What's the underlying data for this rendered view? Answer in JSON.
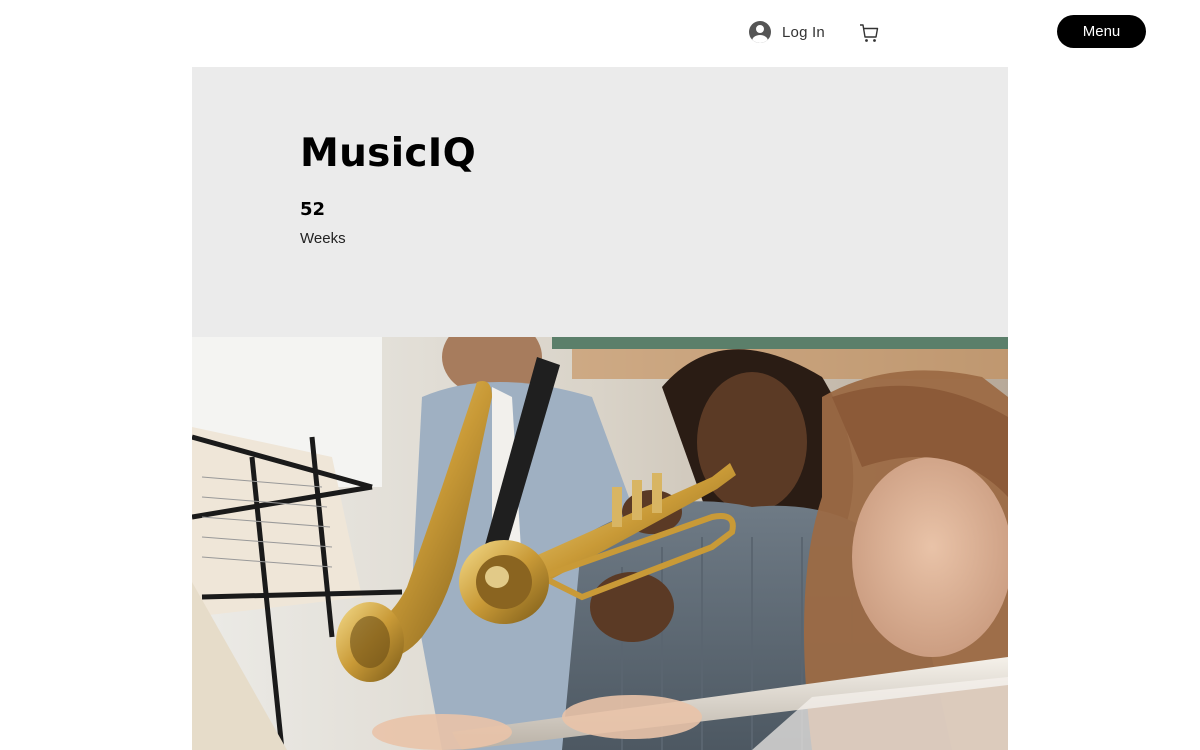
{
  "header": {
    "login_label": "Log In",
    "menu_label": "Menu",
    "icons": {
      "avatar": "user-avatar-icon",
      "cart": "shopping-cart-icon"
    }
  },
  "program": {
    "title": "MusicIQ",
    "duration_value": "52",
    "duration_unit": "Weeks"
  },
  "colors": {
    "hero_background": "#ebebeb",
    "menu_button": "#000000",
    "page_background": "#ffffff"
  }
}
